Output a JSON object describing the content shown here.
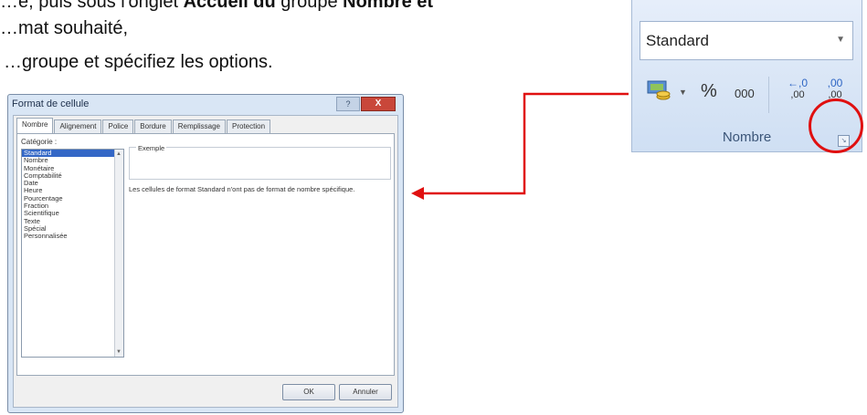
{
  "document": {
    "line1": {
      "pre": "…e, puis sous l'onglet ",
      "bold1": "Accueil du",
      "mid": " groupe ",
      "bold2": "Nombre et"
    },
    "line2": "…mat souhaité,",
    "line3": "…groupe et spécifiez les options."
  },
  "dialog": {
    "title": "Format de cellule",
    "help_label": "?",
    "close_label": "X",
    "tabs": [
      "Nombre",
      "Alignement",
      "Police",
      "Bordure",
      "Remplissage",
      "Protection"
    ],
    "active_tab": "Nombre",
    "category_label": "Catégorie :",
    "categories": [
      "Standard",
      "Nombre",
      "Monétaire",
      "Comptabilité",
      "Date",
      "Heure",
      "Pourcentage",
      "Fraction",
      "Scientifique",
      "Texte",
      "Spécial",
      "Personnalisée"
    ],
    "selected_category": "Standard",
    "sample_label": "Exemple",
    "description": "Les cellules de format Standard n'ont pas de format de nombre spécifique.",
    "ok_label": "OK",
    "cancel_label": "Annuler"
  },
  "ribbon": {
    "format_value": "Standard",
    "percent_label": "%",
    "thousands_label": "000",
    "increase_decimal_label": ",00",
    "decrease_decimal_label": ",00",
    "group_label": "Nombre"
  },
  "colors": {
    "annotation": "#e01010",
    "selection": "#3367c6"
  },
  "icons": [
    "money-format-icon",
    "dropdown-arrow-icon",
    "increase-decimal-icon",
    "decrease-decimal-icon",
    "dialog-launcher-icon"
  ]
}
